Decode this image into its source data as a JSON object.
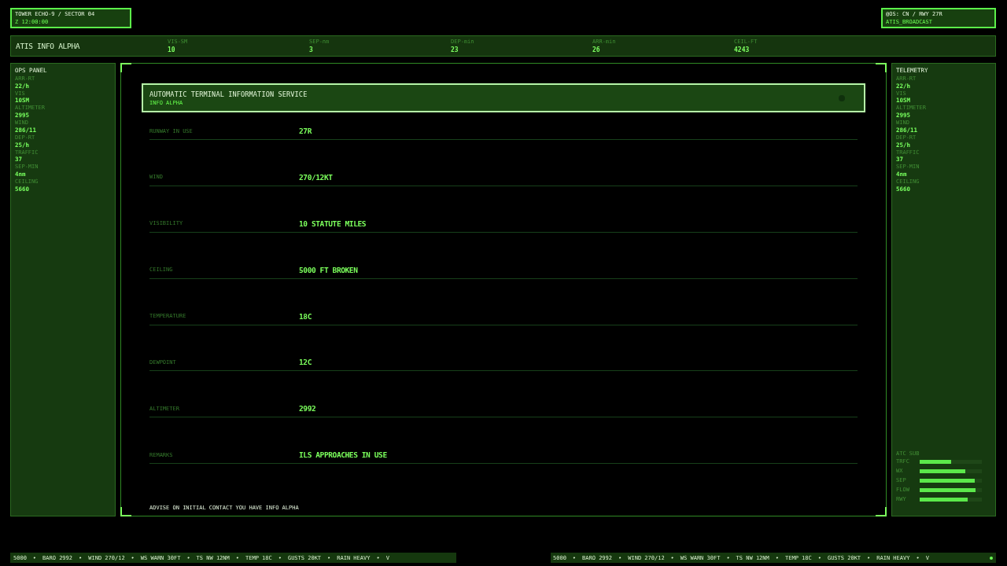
{
  "station_box": {
    "name": "TOWER ECHO-9 / SECTOR 04",
    "time": "Z 12:00:00"
  },
  "mode_box": {
    "status": "@OS: CN / RWY 27R",
    "mode": "ATIS_BROADCAST"
  },
  "header_bar": {
    "title": "ATIS INFO ALPHA",
    "stats": [
      {
        "label": "VIS-SM",
        "value": "10"
      },
      {
        "label": "SEP-nm",
        "value": "3"
      },
      {
        "label": "DEP-min",
        "value": "23"
      },
      {
        "label": "ARR-min",
        "value": "26"
      },
      {
        "label": "CEIL-FT",
        "value": "4243"
      }
    ]
  },
  "ops_panel": {
    "title": "OPS PANEL",
    "items": [
      {
        "label": "ARR-RT",
        "value": "22/h"
      },
      {
        "label": "VIS",
        "value": "10SM"
      },
      {
        "label": "ALTIMETER",
        "value": "2995"
      },
      {
        "label": "WIND",
        "value": "286/11"
      },
      {
        "label": "DEP-RT",
        "value": "25/h"
      },
      {
        "label": "TRAFFIC",
        "value": "37"
      },
      {
        "label": "SEP-MIN",
        "value": "4nm"
      },
      {
        "label": "CEILING",
        "value": "5660"
      }
    ]
  },
  "atis_panel": {
    "title": "AUTOMATIC TERMINAL INFORMATION SERVICE",
    "subtitle": "INFO ALPHA",
    "rows": [
      {
        "label": "RUNWAY IN USE",
        "value": "27R"
      },
      {
        "label": "WIND",
        "value": "270/12KT"
      },
      {
        "label": "VISIBILITY",
        "value": "10 STATUTE MILES"
      },
      {
        "label": "CEILING",
        "value": "5000 FT BROKEN"
      },
      {
        "label": "TEMPERATURE",
        "value": "18C"
      },
      {
        "label": "DEWPOINT",
        "value": "12C"
      },
      {
        "label": "ALTIMETER",
        "value": "2992"
      },
      {
        "label": "REMARKS",
        "value": "ILS APPROACHES IN USE"
      }
    ],
    "footer_note": "ADVISE ON INITIAL CONTACT YOU HAVE INFO ALPHA"
  },
  "telemetry_panel": {
    "title": "TELEMETRY",
    "items": [
      {
        "label": "ARR-RT",
        "value": "22/h"
      },
      {
        "label": "VIS",
        "value": "10SM"
      },
      {
        "label": "ALTIMETER",
        "value": "2995"
      },
      {
        "label": "WIND",
        "value": "286/11"
      },
      {
        "label": "DEP-RT",
        "value": "25/h"
      },
      {
        "label": "TRAFFIC",
        "value": "37"
      },
      {
        "label": "SEP-MIN",
        "value": "4nm"
      },
      {
        "label": "CEILING",
        "value": "5660"
      }
    ],
    "gauges": {
      "title": "ATC SUB",
      "items": [
        {
          "label": "TRFC",
          "level": 0.5
        },
        {
          "label": "WX",
          "level": 0.73
        },
        {
          "label": "SEP",
          "level": 0.88
        },
        {
          "label": "FLOW",
          "level": 0.9
        },
        {
          "label": "RWY",
          "level": 0.77
        }
      ]
    }
  },
  "tickers": [
    {
      "separator": "•",
      "live": false,
      "items": [
        "5000",
        "BARO 2992",
        "WIND 270/12",
        "WS WARN 30FT",
        "TS NW 12NM",
        "TEMP 18C",
        "GUSTS 20KT",
        "RAIN HEAVY",
        "V"
      ]
    },
    {
      "separator": "•",
      "live": true,
      "items": [
        "5000",
        "BARO 2992",
        "WIND 270/12",
        "WS WARN 30FT",
        "TS NW 12NM",
        "TEMP 18C",
        "GUSTS 20KT",
        "RAIN HEAVY",
        "V"
      ]
    }
  ]
}
